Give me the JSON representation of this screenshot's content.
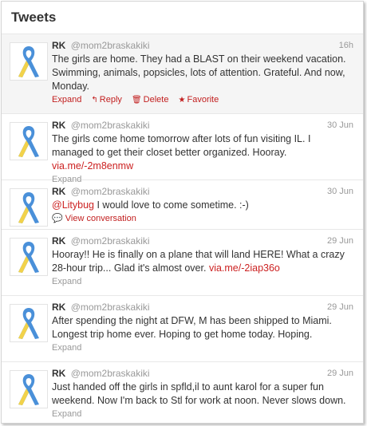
{
  "header": {
    "title": "Tweets"
  },
  "colors": {
    "link": "#cc2222",
    "highlight_row": "#f5f5f5",
    "ribbon_blue": "#4a90d9",
    "ribbon_yellow": "#f2d24a"
  },
  "avatar_icon": "awareness-ribbon",
  "tweets": [
    {
      "name": "RK",
      "handle": "@mom2braskakiki",
      "time": "16h",
      "text": "The girls are home. They had a BLAST on their weekend vacation. Swimming, animals, popsicles, lots of attention. Grateful. And now, Monday.",
      "link": "",
      "expand": "Expand",
      "reply": "Reply",
      "delete": "Delete",
      "favorite": "Favorite"
    },
    {
      "name": "RK",
      "handle": "@mom2braskakiki",
      "time": "30 Jun",
      "text": "The girls come home tomorrow after lots of fun visiting IL. I managed to get their closet better organized. Hooray.",
      "link": "via.me/-2m8enmw",
      "expand": "Expand"
    },
    {
      "name": "RK",
      "handle": "@mom2braskakiki",
      "time": "30 Jun",
      "mention": "@Litybug",
      "text": "I would love to come sometime. :-)",
      "conversation": "View conversation"
    },
    {
      "name": "RK",
      "handle": "@mom2braskakiki",
      "time": "29 Jun",
      "text": "Hooray!! He is finally on a plane that will land HERE! What a crazy 28-hour trip... Glad it's almost over.",
      "link": "via.me/-2iap36o",
      "expand": "Expand"
    },
    {
      "name": "RK",
      "handle": "@mom2braskakiki",
      "time": "29 Jun",
      "text": "After spending the night at DFW, M has been shipped to Miami. Longest trip home ever. Hoping to get home today. Hoping.",
      "expand": "Expand"
    },
    {
      "name": "RK",
      "handle": "@mom2braskakiki",
      "time": "29 Jun",
      "text": "Just handed off the girls in spfld,il to aunt karol for a super fun weekend. Now I'm back to Stl for work at noon. Never slows down.",
      "expand": "Expand"
    }
  ]
}
